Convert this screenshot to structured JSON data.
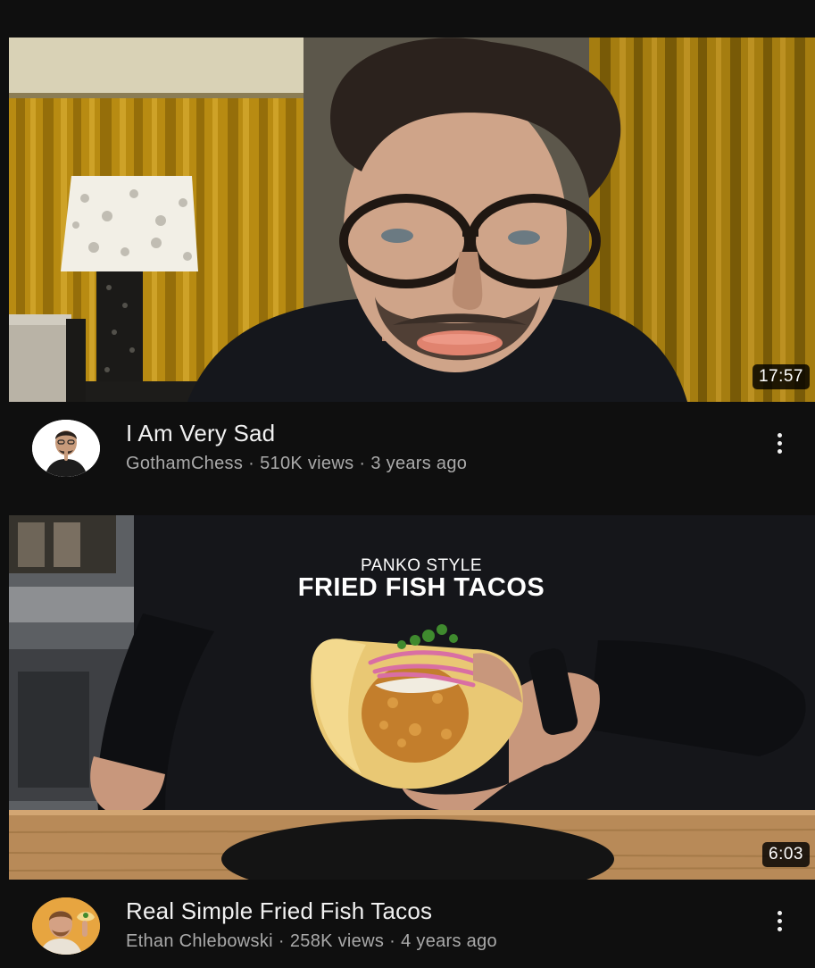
{
  "videos": [
    {
      "title": "I Am Very Sad",
      "channel": "GothamChess",
      "views": "510K views",
      "age": "3 years ago",
      "duration": "17:57",
      "avatar_icon": "channel-avatar-man-shush",
      "thumbnail_icon": "thumbnail-sad-man-glasses"
    },
    {
      "title": "Real Simple Fried Fish Tacos",
      "channel": "Ethan Chlebowski",
      "views": "258K views",
      "age": "4 years ago",
      "duration": "6:03",
      "thumbnail_overline": "PANKO STYLE",
      "thumbnail_headline": "FRIED FISH TACOS",
      "avatar_icon": "channel-avatar-man-taco",
      "thumbnail_icon": "thumbnail-fish-taco-hand"
    }
  ],
  "separator": "·",
  "menu_icon": "more-vert-icon",
  "colors": {
    "background": "#0f0f0f",
    "title": "#f1f1f1",
    "secondary": "#aaaaaa",
    "curtain": "#c49a1a"
  }
}
